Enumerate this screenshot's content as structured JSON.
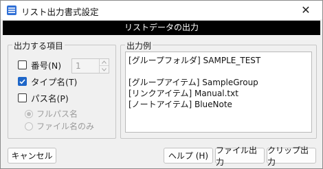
{
  "window": {
    "title": "リスト出力書式設定",
    "close_glyph": "✕"
  },
  "header": {
    "title": "リストデータの出力"
  },
  "items_group": {
    "label": "出力する項目",
    "number": {
      "label": "番号(N)",
      "checked": false,
      "spin_value": "1"
    },
    "type_name": {
      "label": "タイプ名(T)",
      "checked": true
    },
    "path_name": {
      "label": "パス名(P)",
      "checked": false
    },
    "full_path": {
      "label": "フルパス名",
      "selected": true,
      "enabled": false
    },
    "file_name_only": {
      "label": "ファイル名のみ",
      "selected": false,
      "enabled": false
    }
  },
  "output_group": {
    "label": "出力例",
    "lines": [
      "[グループフォルダ] SAMPLE_TEST",
      "",
      "[グループアイテム] SampleGroup",
      "[リンクアイテム] Manual.txt",
      "[ノートアイテム] BlueNote"
    ]
  },
  "buttons": {
    "cancel": "キャンセル",
    "help": "ヘルプ (H)",
    "file_output": "ファイル出力",
    "clip_output": "クリップ出力"
  },
  "colors": {
    "accent": "#1e66c8",
    "header_bg": "#000000",
    "dialog_bg": "#f0f0f0"
  },
  "icons": {
    "app": "list-window-icon",
    "close": "close-icon",
    "check": "checkmark-icon",
    "spin_up": "chevron-up-icon",
    "spin_down": "chevron-down-icon"
  }
}
